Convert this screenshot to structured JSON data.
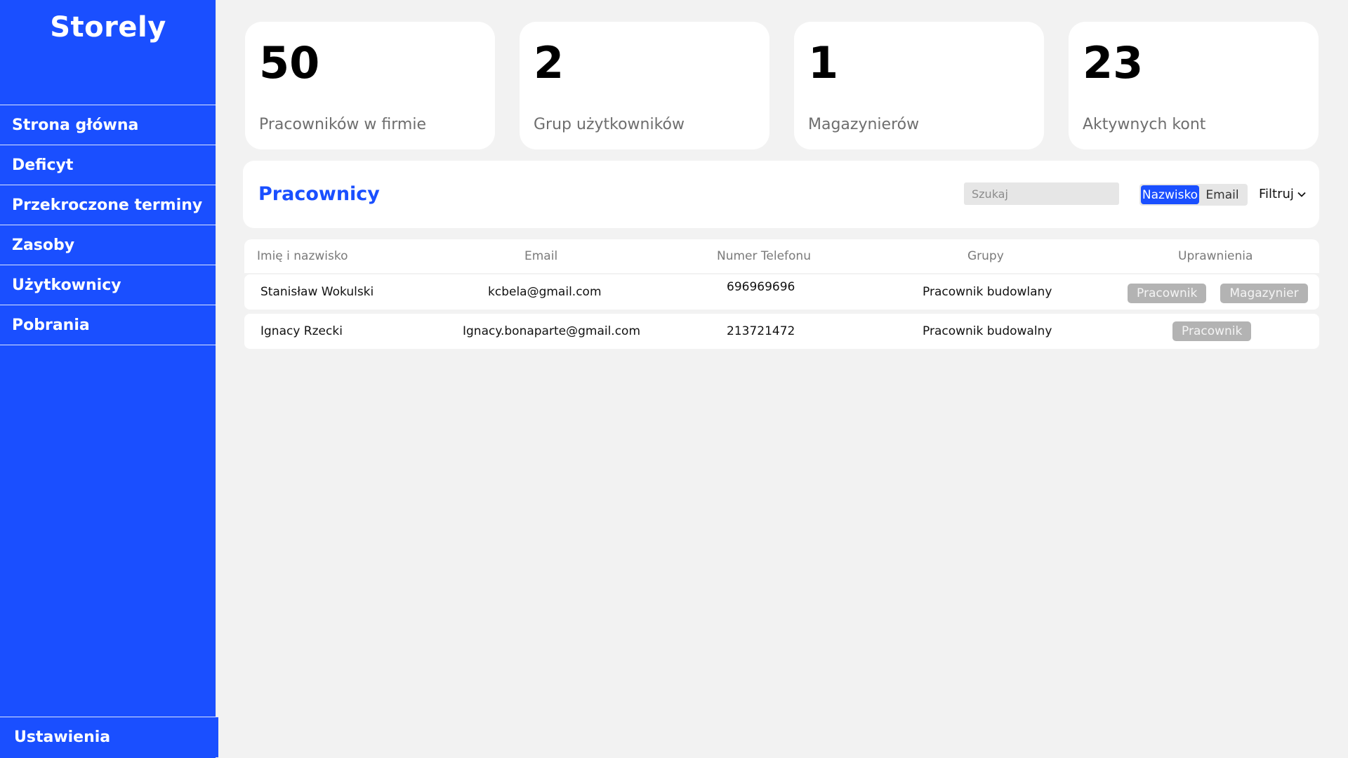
{
  "app": {
    "name": "Storely"
  },
  "sidebar": {
    "items": [
      {
        "label": "Strona główna"
      },
      {
        "label": "Deficyt"
      },
      {
        "label": "Przekroczone terminy"
      },
      {
        "label": "Zasoby"
      },
      {
        "label": "Użytkownicy"
      },
      {
        "label": "Pobrania"
      }
    ],
    "settings_label": "Ustawienia"
  },
  "stats": [
    {
      "value": "50",
      "label": "Pracowników w firmie"
    },
    {
      "value": "2",
      "label": "Grup użytkowników"
    },
    {
      "value": "1",
      "label": "Magazynierów"
    },
    {
      "value": "23",
      "label": "Aktywnych kont"
    }
  ],
  "employees": {
    "title": "Pracownicy",
    "search_placeholder": "Szukaj",
    "search_modes": {
      "active": "Nazwisko",
      "other": "Email"
    },
    "filter_label": "Filtruj",
    "columns": {
      "name": "Imię i nazwisko",
      "email": "Email",
      "phone": "Numer Telefonu",
      "group": "Grupy",
      "permissions": "Uprawnienia"
    },
    "rows": [
      {
        "name": "Stanisław Wokulski",
        "email": "kcbela@gmail.com",
        "phone": "696969696",
        "group": "Pracownik budowlany",
        "permissions": [
          "Pracownik",
          "Magazynier"
        ]
      },
      {
        "name": "Ignacy Rzecki",
        "email": "Ignacy.bonaparte@gmail.com",
        "phone": "213721472",
        "group": "Pracownik budowalny",
        "permissions": [
          "Pracownik"
        ]
      }
    ]
  },
  "colors": {
    "accent": "#1a4fff",
    "background": "#f2f2f2",
    "badge": "#b3b3b3"
  }
}
